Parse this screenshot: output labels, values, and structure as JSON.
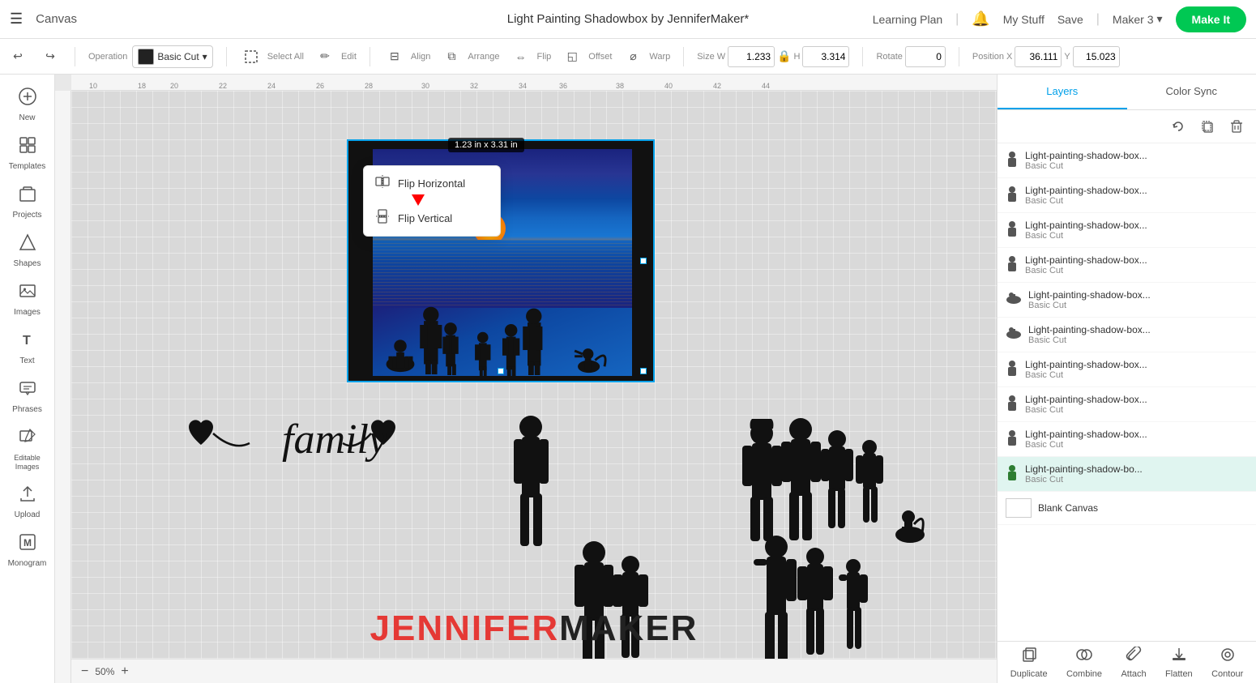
{
  "header": {
    "menu_label": "☰",
    "canvas_label": "Canvas",
    "project_title": "Light Painting Shadowbox by JenniferMaker*",
    "learning": "Learning Plan",
    "divider": "|",
    "bell": "🔔",
    "mystuff": "My Stuff",
    "save": "Save",
    "maker": "Maker 3",
    "make_it": "Make It"
  },
  "toolbar": {
    "undo": "↩",
    "redo": "↪",
    "operation_label": "Operation",
    "operation_value": "Basic Cut",
    "select_all": "Select All",
    "edit": "Edit",
    "align": "Align",
    "arrange": "Arrange",
    "flip": "Flip",
    "offset": "Offset",
    "warp": "Warp",
    "size_label": "Size",
    "w_label": "W",
    "w_value": "1.233",
    "h_label": "H",
    "h_value": "3.314",
    "rotate_label": "Rotate",
    "rotate_value": "0",
    "position_label": "Position",
    "x_label": "X",
    "x_value": "36.111",
    "y_label": "Y",
    "y_value": "15.023"
  },
  "flip_dropdown": {
    "flip_horizontal": "Flip Horizontal",
    "flip_vertical": "Flip Vertical"
  },
  "canvas": {
    "zoom": "50%",
    "size_tooltip": "1.23  in x 3.31  in"
  },
  "sidebar": {
    "items": [
      {
        "label": "New",
        "icon": "+"
      },
      {
        "label": "Templates",
        "icon": "⊞"
      },
      {
        "label": "Projects",
        "icon": "📁"
      },
      {
        "label": "Shapes",
        "icon": "◇"
      },
      {
        "label": "Images",
        "icon": "🖼"
      },
      {
        "label": "Text",
        "icon": "T"
      },
      {
        "label": "Phrases",
        "icon": "💬"
      },
      {
        "label": "Editable\nImages",
        "icon": "✏️"
      },
      {
        "label": "Upload",
        "icon": "⬆"
      },
      {
        "label": "Monogram",
        "icon": "M"
      }
    ]
  },
  "right_panel": {
    "tabs": [
      {
        "label": "Layers",
        "active": true
      },
      {
        "label": "Color Sync",
        "active": false
      }
    ],
    "layers": [
      {
        "name": "Light-painting-shadow-box...",
        "type": "Basic Cut",
        "icon": "👤",
        "active": false
      },
      {
        "name": "Light-painting-shadow-box...",
        "type": "Basic Cut",
        "icon": "👤",
        "active": false
      },
      {
        "name": "Light-painting-shadow-box...",
        "type": "Basic Cut",
        "icon": "👤",
        "active": false
      },
      {
        "name": "Light-painting-shadow-box...",
        "type": "Basic Cut",
        "icon": "👤",
        "active": false
      },
      {
        "name": "Light-painting-shadow-box...",
        "type": "Basic Cut",
        "icon": "🐕",
        "active": false
      },
      {
        "name": "Light-painting-shadow-box...",
        "type": "Basic Cut",
        "icon": "🐕",
        "active": false
      },
      {
        "name": "Light-painting-shadow-box...",
        "type": "Basic Cut",
        "icon": "👤",
        "active": false
      },
      {
        "name": "Light-painting-shadow-box...",
        "type": "Basic Cut",
        "icon": "👤",
        "active": false
      },
      {
        "name": "Light-painting-shadow-box...",
        "type": "Basic Cut",
        "icon": "👤",
        "active": false
      },
      {
        "name": "Light-painting-shadow-bo...",
        "type": "Basic Cut",
        "icon": "👤",
        "active": true
      }
    ],
    "blank_canvas": "Blank Canvas",
    "bottom_buttons": [
      {
        "label": "Duplicate",
        "icon": "⧉"
      },
      {
        "label": "Combine",
        "icon": "⊕"
      },
      {
        "label": "Attach",
        "icon": "📎"
      },
      {
        "label": "Flatten",
        "icon": "⬇"
      },
      {
        "label": "Contour",
        "icon": "◎"
      }
    ]
  },
  "brand": {
    "jennifer": "JENNIFER",
    "maker": "MAKER",
    "jennifer_color": "#e53935",
    "maker_color": "#222"
  }
}
